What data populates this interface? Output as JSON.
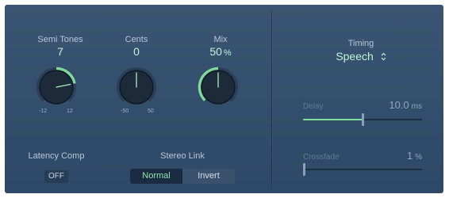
{
  "colors": {
    "panel_bg": "#34506d",
    "accent_green": "#7fd99a",
    "value_text": "#c6f0d2",
    "label_text": "#b9c6d6",
    "dim_label": "#62798f",
    "knob_dark": "#1d2a3a"
  },
  "semi_tones": {
    "label": "Semi Tones",
    "value": "7",
    "numeric": 7,
    "min": -12,
    "max": 12,
    "min_label": "-12",
    "max_label": "12"
  },
  "cents": {
    "label": "Cents",
    "value": "0",
    "numeric": 0,
    "min": -50,
    "max": 50,
    "min_label": "-50",
    "max_label": "50"
  },
  "mix": {
    "label": "Mix",
    "value": "50",
    "unit": "%",
    "numeric": 50,
    "min": 0,
    "max": 100
  },
  "latency_comp": {
    "label": "Latency Comp",
    "value": "OFF"
  },
  "stereo_link": {
    "label": "Stereo Link",
    "options": [
      "Normal",
      "Invert"
    ],
    "selected": "Normal"
  },
  "timing": {
    "label": "Timing",
    "value": "Speech",
    "icon": "updown-chevron-icon"
  },
  "delay": {
    "label": "Delay",
    "value": "10.0",
    "unit": "ms",
    "fill_fraction": 0.5
  },
  "crossfade": {
    "label": "Crossfade",
    "value": "1",
    "unit": "%",
    "fill_fraction": 0.01
  }
}
